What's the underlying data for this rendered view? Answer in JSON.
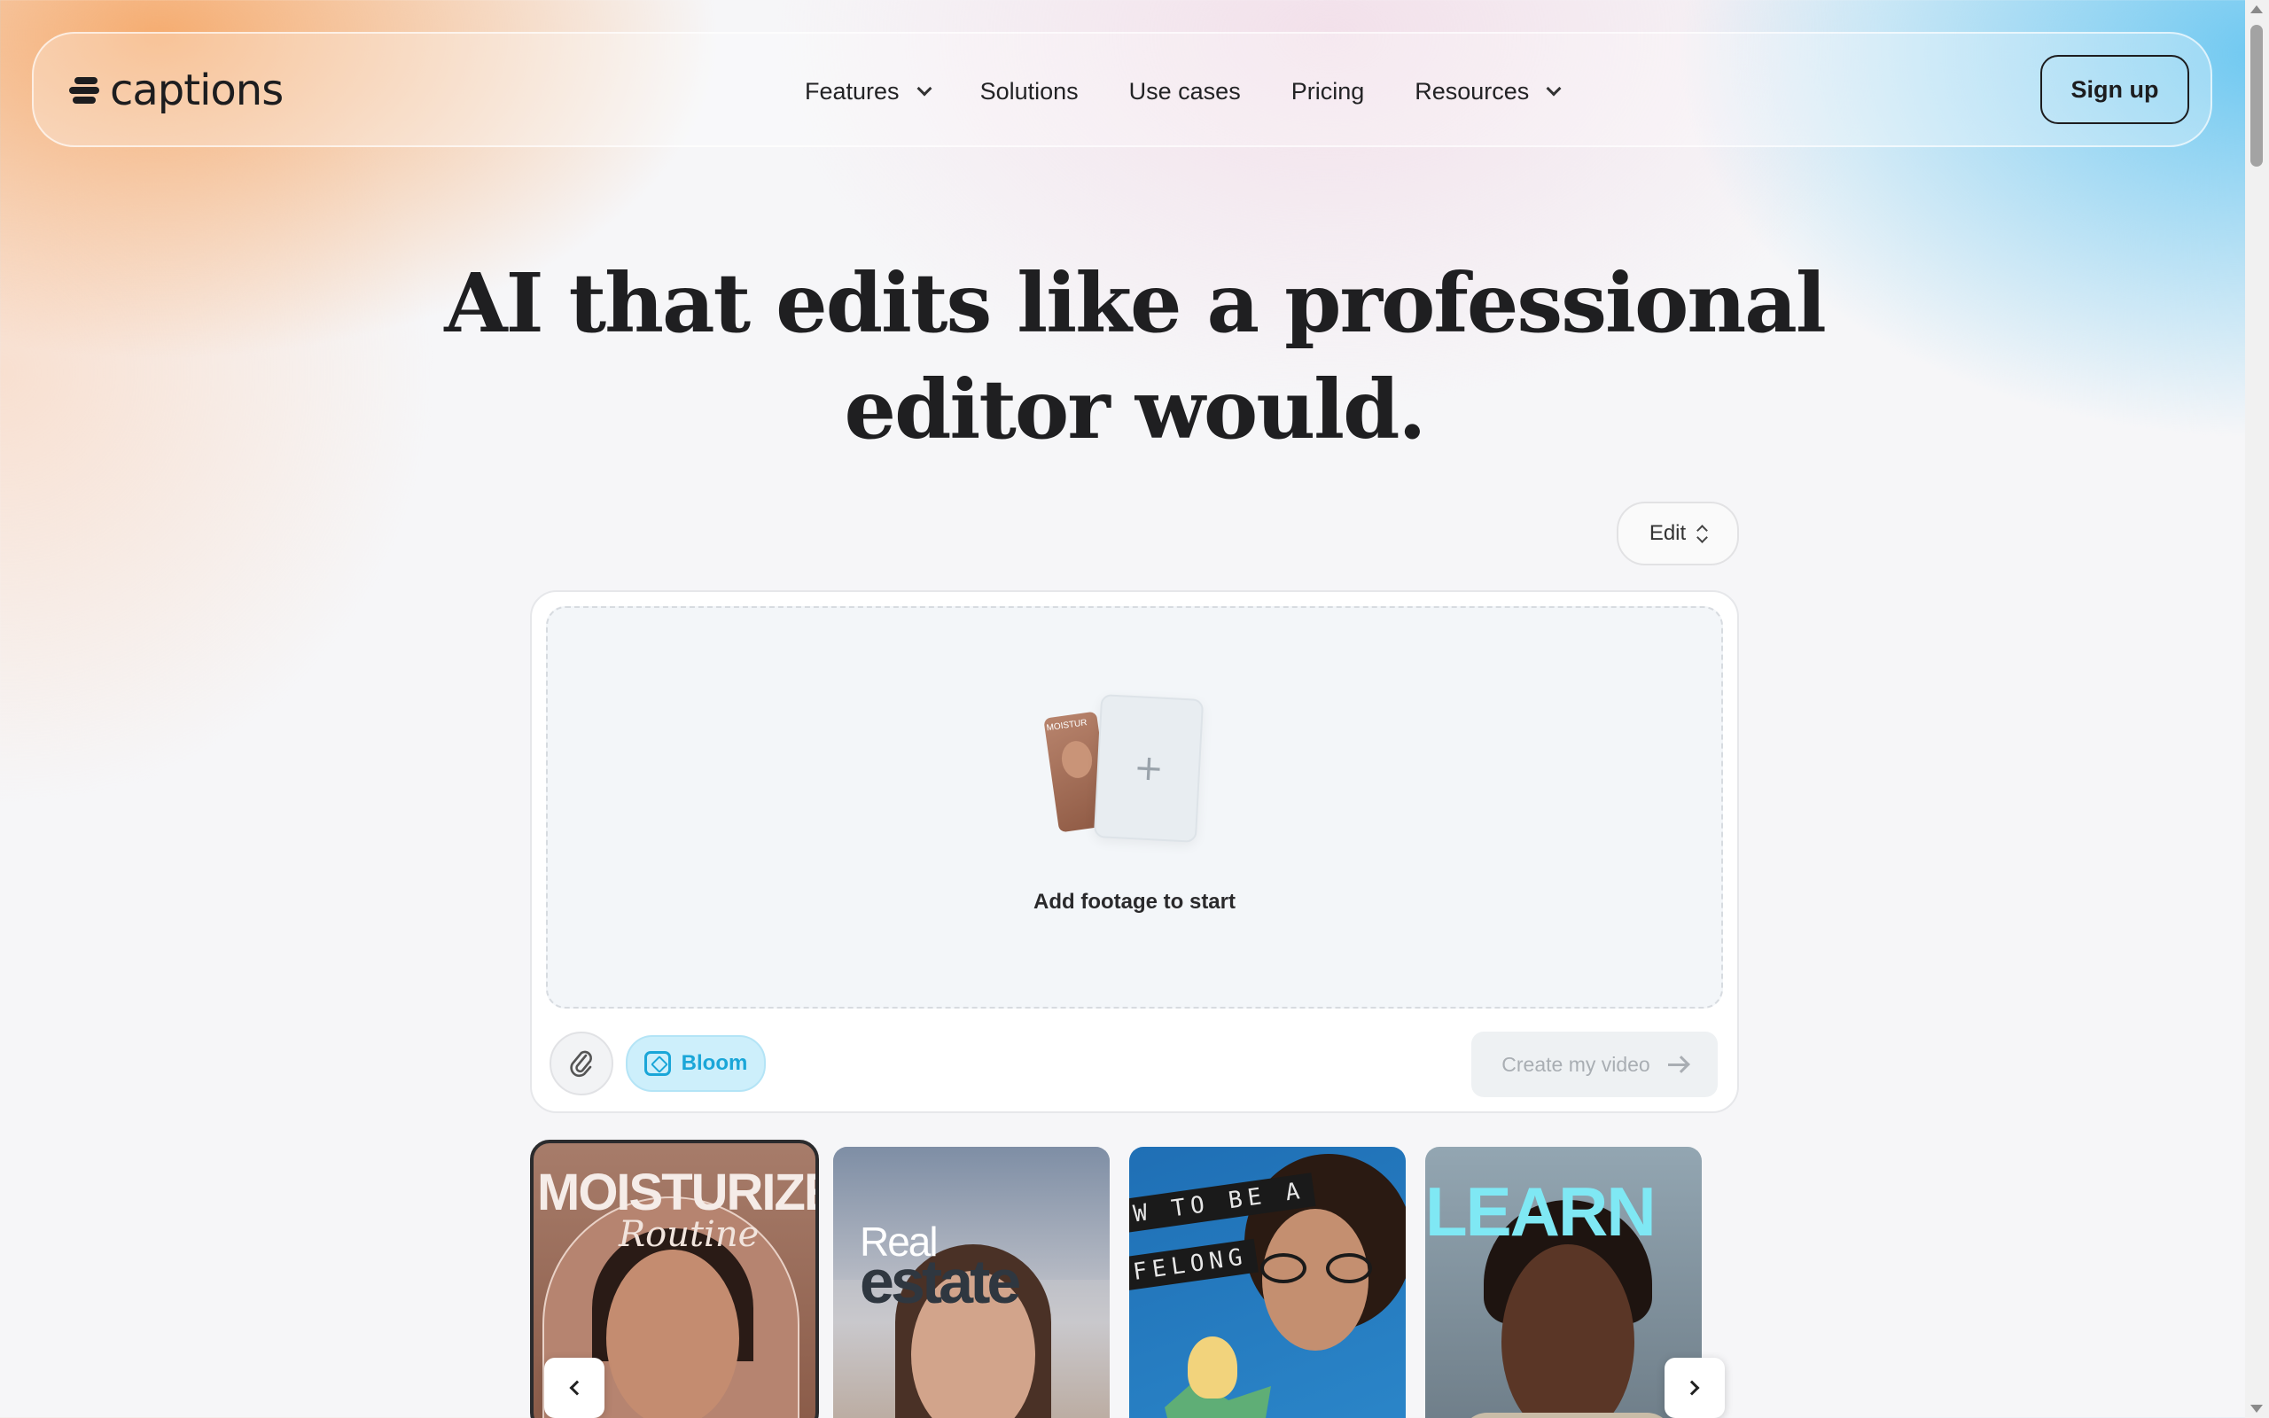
{
  "brand": {
    "name": "captions"
  },
  "nav": {
    "links": [
      {
        "label": "Features",
        "has_dropdown": true
      },
      {
        "label": "Solutions",
        "has_dropdown": false
      },
      {
        "label": "Use cases",
        "has_dropdown": false
      },
      {
        "label": "Pricing",
        "has_dropdown": false
      },
      {
        "label": "Resources",
        "has_dropdown": true
      }
    ],
    "signup_label": "Sign up"
  },
  "hero": {
    "title_line1": "AI that edits like a professional",
    "title_line2": "editor would."
  },
  "mode_select": {
    "value": "Edit"
  },
  "composer": {
    "dropzone_label": "Add footage to start",
    "attach_icon": "paperclip-icon",
    "style_chip": {
      "label": "Bloom",
      "icon": "sparkle-frame-icon",
      "color": "#1aa6d8"
    },
    "create_label": "Create my video"
  },
  "templates": [
    {
      "title": "MOISTURIZE",
      "subtitle": "Routine",
      "selected": true
    },
    {
      "title": "Real",
      "subtitle": "estate",
      "selected": false
    },
    {
      "title": "W TO BE A",
      "subtitle": "FELONG",
      "selected": false
    },
    {
      "title": "LEARN",
      "subtitle": "",
      "selected": false
    }
  ],
  "thumb_label": "MOISTUR",
  "colors": {
    "accent_orange": "#f5a05a",
    "accent_blue": "#5fc3f0",
    "text": "#1d1d1f",
    "bloom": "#1aa6d8"
  }
}
